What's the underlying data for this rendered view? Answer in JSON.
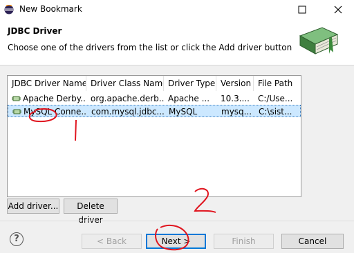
{
  "window": {
    "title": "New Bookmark"
  },
  "banner": {
    "title": "JDBC Driver",
    "description": "Choose one of the drivers from the list or click the Add driver button"
  },
  "table": {
    "columns": [
      "JDBC Driver Name",
      "Driver Class Name",
      "Driver Type",
      "Version",
      "File Path"
    ],
    "rows": [
      {
        "name": "Apache Derby...",
        "class": "org.apache.derb...",
        "type": "Apache ...",
        "version": "10.3....",
        "path": "C:/Use...",
        "selected": false
      },
      {
        "name": "MySQL Conne...",
        "class": "com.mysql.jdbc....",
        "type": "MySQL",
        "version": "mysq...",
        "path": "C:\\sist...",
        "selected": true
      }
    ]
  },
  "buttons": {
    "add_driver": "Add driver...",
    "delete_driver": "Delete driver",
    "back": "< Back",
    "next": "Next >",
    "finish": "Finish",
    "cancel": "Cancel",
    "help": "?"
  },
  "annotations": {
    "mark_1": "1",
    "mark_2": "2"
  },
  "colors": {
    "annotation_red": "#e0141e",
    "selection": "#cce8ff",
    "book_green": "#5a9a5a"
  }
}
